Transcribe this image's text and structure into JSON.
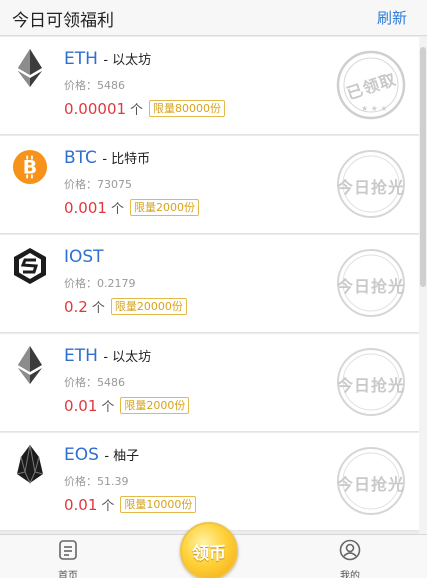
{
  "header": {
    "title": "今日可领福利",
    "refresh": "刷新"
  },
  "items": [
    {
      "icon": "ethereum-icon",
      "symbol": "ETH",
      "sub": "- 以太坊",
      "price_label": "价格：",
      "price": "5486",
      "amount": "0.00001",
      "unit": "个",
      "limit": "限量80000份",
      "stamp": "已领取",
      "stamp_state": "claimed"
    },
    {
      "icon": "bitcoin-icon",
      "symbol": "BTC",
      "sub": "- 比特币",
      "price_label": "价格：",
      "price": "73075",
      "amount": "0.001",
      "unit": "个",
      "limit": "限量2000份",
      "stamp": "今日抢光",
      "stamp_state": "sold-out"
    },
    {
      "icon": "iost-icon",
      "symbol": "IOST",
      "sub": "",
      "price_label": "价格：",
      "price": "0.2179",
      "amount": "0.2",
      "unit": "个",
      "limit": "限量20000份",
      "stamp": "今日抢光",
      "stamp_state": "sold-out"
    },
    {
      "icon": "ethereum-icon",
      "symbol": "ETH",
      "sub": "- 以太坊",
      "price_label": "价格：",
      "price": "5486",
      "amount": "0.01",
      "unit": "个",
      "limit": "限量2000份",
      "stamp": "今日抢光",
      "stamp_state": "sold-out"
    },
    {
      "icon": "eos-icon",
      "symbol": "EOS",
      "sub": "- 柚子",
      "price_label": "价格：",
      "price": "51.39",
      "amount": "0.01",
      "unit": "个",
      "limit": "限量10000份",
      "stamp": "今日抢光",
      "stamp_state": "sold-out"
    }
  ],
  "tabbar": {
    "home": {
      "label": "首页",
      "icon": "document-icon"
    },
    "center": {
      "label": "领币",
      "icon": "gold-coin-icon"
    },
    "mine": {
      "label": "我的",
      "icon": "user-icon"
    }
  },
  "colors": {
    "accent": "#2f6fd0",
    "amount": "#e0383e",
    "limit": "#d6a31c",
    "stamp": "#c9c9c9"
  }
}
